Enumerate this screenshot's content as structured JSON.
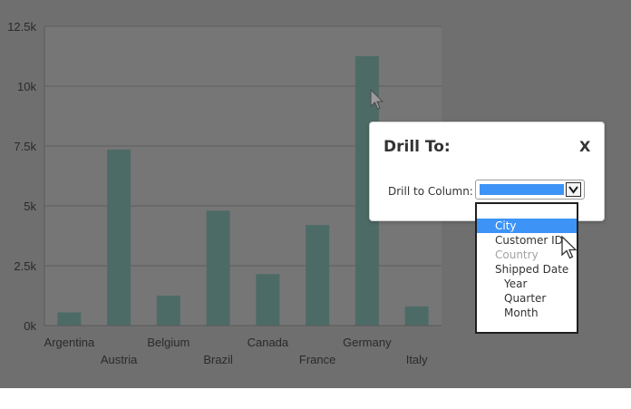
{
  "chart_data": {
    "type": "bar",
    "categories": [
      "Argentina",
      "Austria",
      "Belgium",
      "Brazil",
      "Canada",
      "France",
      "Germany",
      "Italy"
    ],
    "values": [
      550,
      7350,
      1250,
      4800,
      2150,
      4200,
      11250,
      800
    ],
    "ylim": [
      0,
      12500
    ],
    "yticks": [
      0,
      2500,
      5000,
      7500,
      10000,
      12500
    ],
    "ytick_labels": [
      "0k",
      "2.5k",
      "5k",
      "7.5k",
      "10k",
      "12.5k"
    ],
    "title": "",
    "xlabel": "",
    "ylabel": "",
    "grid": true,
    "legend": "none",
    "bar_color": "#4d6b66"
  },
  "dialog": {
    "title": "Drill To:",
    "close_label": "X",
    "column_label": "Drill to Column:",
    "select_arrow_icon": "chevron-down-icon",
    "options": [
      {
        "label": "",
        "state": "blank"
      },
      {
        "label": "City",
        "state": "selected"
      },
      {
        "label": "Customer ID",
        "state": "normal"
      },
      {
        "label": "Country",
        "state": "disabled"
      },
      {
        "label": "Shipped Date",
        "state": "normal"
      },
      {
        "label": "Year",
        "state": "indented"
      },
      {
        "label": "Quarter",
        "state": "indented"
      },
      {
        "label": "Month",
        "state": "indented"
      }
    ]
  },
  "colors": {
    "overlay": "#6f6f6f",
    "selected": "#3d94f6",
    "disabled_text": "#a3a3a3"
  }
}
